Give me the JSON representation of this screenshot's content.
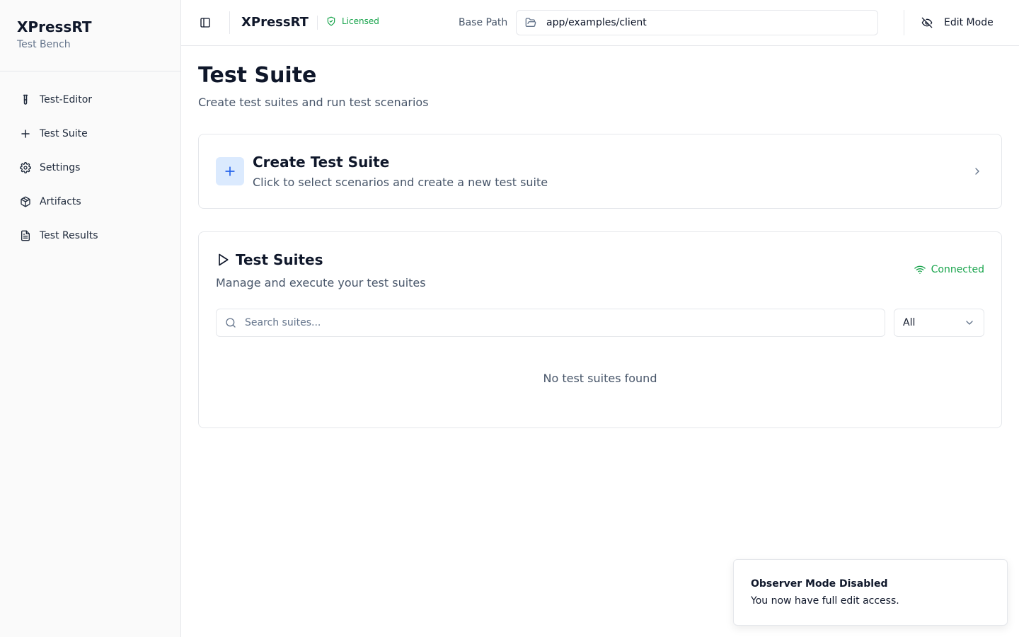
{
  "sidebar": {
    "app_name": "XPressRT",
    "app_sub": "Test Bench",
    "items": [
      {
        "label": "Test-Editor",
        "icon": "test-tube-icon"
      },
      {
        "label": "Test Suite",
        "icon": "plus-icon"
      },
      {
        "label": "Settings",
        "icon": "gear-icon"
      },
      {
        "label": "Artifacts",
        "icon": "package-icon"
      },
      {
        "label": "Test Results",
        "icon": "file-text-icon"
      }
    ]
  },
  "topbar": {
    "brand": "XPressRT",
    "licensed": "Licensed",
    "base_path_label": "Base Path",
    "base_path_value": "app/examples/client",
    "edit_mode": "Edit Mode"
  },
  "main": {
    "title": "Test Suite",
    "subtitle": "Create test suites and run test scenarios",
    "create_card": {
      "title": "Create Test Suite",
      "subtitle": "Click to select scenarios and create a new test suite"
    },
    "suites_card": {
      "title": "Test Suites",
      "subtitle": "Manage and execute your test suites",
      "status": "Connected",
      "search_placeholder": "Search suites...",
      "filter_value": "All",
      "empty_text": "No test suites found"
    }
  },
  "toast": {
    "title": "Observer Mode Disabled",
    "description": "You now have full edit access."
  },
  "colors": {
    "accent": "#2563eb",
    "accent_bg": "#dbeafe",
    "success": "#16a34a",
    "border": "#e5e7eb",
    "sidebar_bg": "#fafafa"
  }
}
